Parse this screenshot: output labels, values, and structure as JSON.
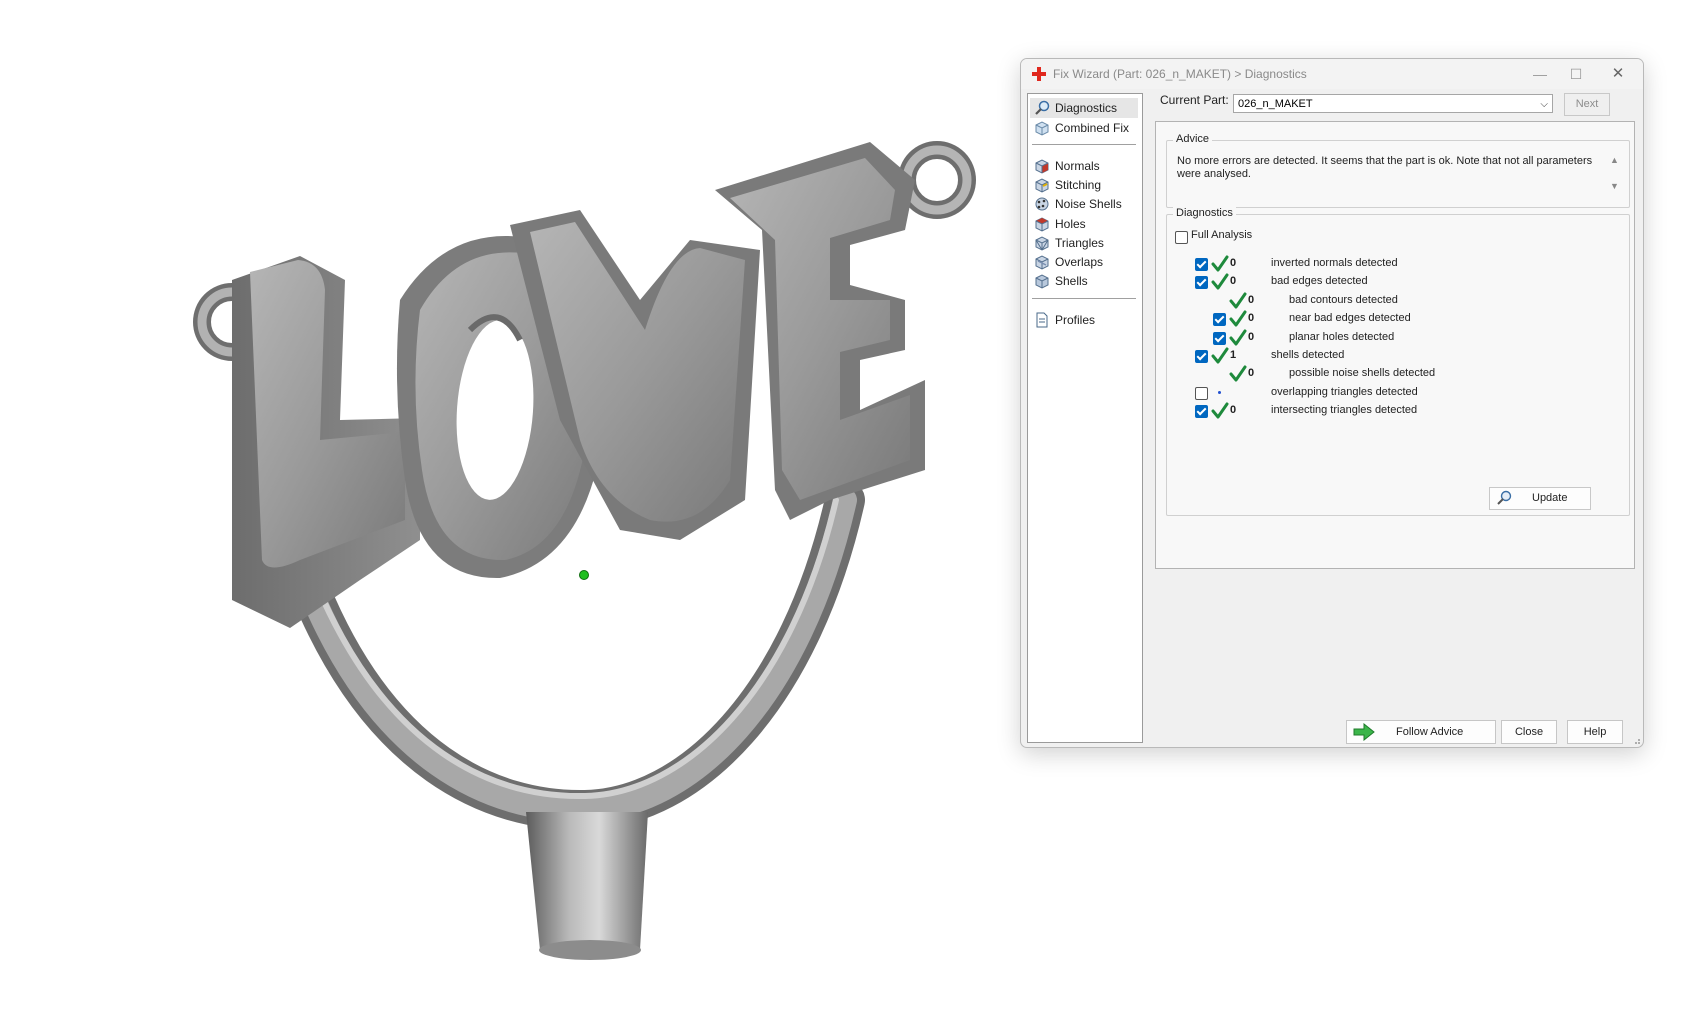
{
  "dialog": {
    "title": "Fix Wizard (Part: 026_n_MAKET) > Diagnostics",
    "current_part_label": "Current Part:",
    "current_part_value": "026_n_MAKET",
    "next_label": "Next",
    "nav": {
      "items": [
        {
          "label": "Diagnostics",
          "icon": "diagnostics-magnifier-icon"
        },
        {
          "label": "Combined Fix",
          "icon": "combined-fix-icon"
        },
        {
          "label": "Normals",
          "icon": "normals-cube-icon"
        },
        {
          "label": "Stitching",
          "icon": "stitching-cube-icon"
        },
        {
          "label": "Noise Shells",
          "icon": "noise-shells-icon"
        },
        {
          "label": "Holes",
          "icon": "holes-cube-icon"
        },
        {
          "label": "Triangles",
          "icon": "triangles-cube-icon"
        },
        {
          "label": "Overlaps",
          "icon": "overlaps-cube-icon"
        },
        {
          "label": "Shells",
          "icon": "shells-cube-icon"
        },
        {
          "label": "Profiles",
          "icon": "profiles-document-icon"
        }
      ]
    },
    "advice": {
      "title": "Advice",
      "text": "No more errors are detected. It seems that the part is ok. Note that not all parameters were analysed."
    },
    "diagnostics": {
      "title": "Diagnostics",
      "full_analysis_label": "Full Analysis",
      "full_analysis_checked": false,
      "rows": [
        {
          "checkbox": "checked",
          "status": "ok",
          "count": "0",
          "text": "inverted normals detected",
          "indent": 0
        },
        {
          "checkbox": "checked",
          "status": "ok",
          "count": "0",
          "text": "bad edges detected",
          "indent": 0
        },
        {
          "checkbox": "none",
          "status": "ok",
          "count": "0",
          "text": "bad contours detected",
          "indent": 1
        },
        {
          "checkbox": "checked",
          "status": "ok",
          "count": "0",
          "text": "near bad edges detected",
          "indent": 1
        },
        {
          "checkbox": "checked",
          "status": "ok",
          "count": "0",
          "text": "planar holes detected",
          "indent": 1
        },
        {
          "checkbox": "checked",
          "status": "ok",
          "count": "1",
          "text": "shells detected",
          "indent": 0
        },
        {
          "checkbox": "none",
          "status": "ok",
          "count": "0",
          "text": "possible noise shells detected",
          "indent": 1
        },
        {
          "checkbox": "unchecked",
          "status": "dot",
          "count": "",
          "text": "overlapping triangles detected",
          "indent": 0
        },
        {
          "checkbox": "checked",
          "status": "ok",
          "count": "0",
          "text": "intersecting triangles detected",
          "indent": 0
        }
      ],
      "update_label": "Update"
    },
    "buttons": {
      "follow_advice": "Follow Advice",
      "close": "Close",
      "help": "Help"
    },
    "colors": {
      "check_green": "#1e8a3c",
      "checkbox_blue": "#0067c0",
      "app_icon_red": "#e0281e"
    }
  }
}
